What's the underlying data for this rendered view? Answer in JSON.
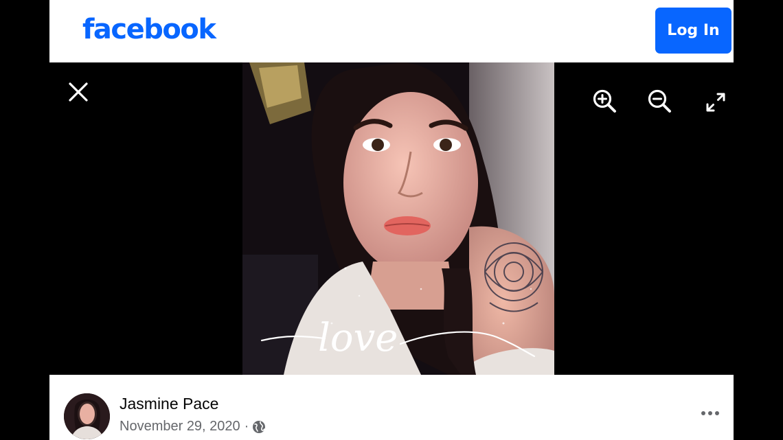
{
  "header": {
    "logo_text": "facebook",
    "login_label": "Log In",
    "brand_color": "#0866ff"
  },
  "viewer": {
    "controls": {
      "close_icon": "close-icon",
      "zoom_in_icon": "zoom-in-icon",
      "zoom_out_icon": "zoom-out-icon",
      "fullscreen_icon": "fullscreen-icon"
    },
    "photo": {
      "overlay_text": "love"
    }
  },
  "post": {
    "author_name": "Jasmine Pace",
    "date": "November 29, 2020",
    "separator": "·",
    "privacy_icon": "globe-icon",
    "more_icon": "more-options-icon"
  }
}
